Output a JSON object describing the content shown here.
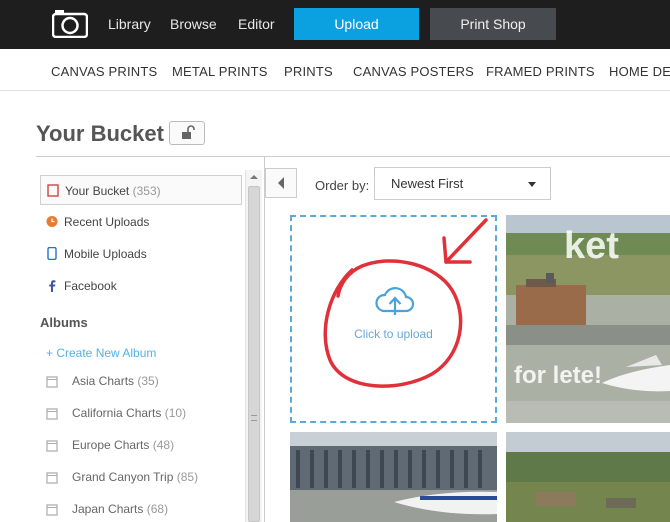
{
  "topnav": {
    "links": [
      "Library",
      "Browse",
      "Editor"
    ],
    "upload_label": "Upload",
    "print_label": "Print Shop",
    "logo_icon": "camera-logo-icon"
  },
  "categories": [
    "CANVAS PRINTS",
    "METAL PRINTS",
    "PRINTS",
    "CANVAS POSTERS",
    "FRAMED PRINTS",
    "HOME DE"
  ],
  "page": {
    "title": "Your Bucket",
    "lock_icon": "unlock-icon"
  },
  "sidebar": {
    "items": [
      {
        "label": "Your Bucket",
        "count": "(353)",
        "icon": "bucket-icon"
      },
      {
        "label": "Recent Uploads",
        "count": "",
        "icon": "clock-icon"
      },
      {
        "label": "Mobile Uploads",
        "count": "",
        "icon": "phone-icon"
      },
      {
        "label": "Facebook",
        "count": "",
        "icon": "facebook-icon"
      }
    ],
    "albums_heading": "Albums",
    "create_album": "+ Create New Album",
    "albums": [
      {
        "label": "Asia Charts",
        "count": "(35)"
      },
      {
        "label": "California Charts",
        "count": "(10)"
      },
      {
        "label": "Europe Charts",
        "count": "(48)"
      },
      {
        "label": "Grand Canyon Trip",
        "count": "(85)"
      },
      {
        "label": "Japan Charts",
        "count": "(68)"
      }
    ]
  },
  "toolbar": {
    "order_label": "Order by:",
    "order_value": "Newest First"
  },
  "grid": {
    "upload_label": "Click to upload",
    "photo1_overlay": "ket",
    "photo1_caption": "for lete!"
  },
  "colors": {
    "accent": "#0ba0e0",
    "topbar": "#1e1e1e",
    "dropzone_border": "#5aa9d8",
    "annotation_red": "#e0303a"
  }
}
